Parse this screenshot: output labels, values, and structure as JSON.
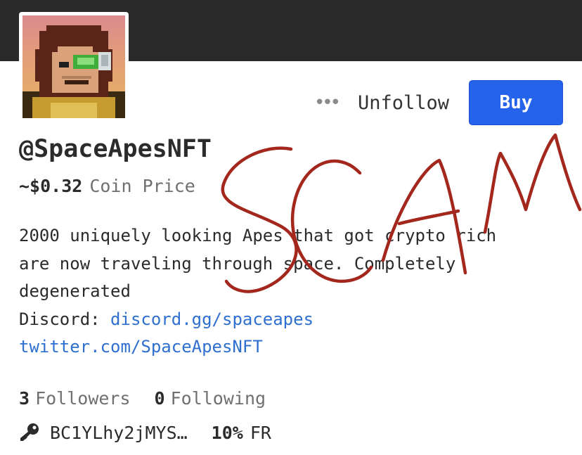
{
  "profile": {
    "handle": "@SpaceApesNFT",
    "coin_price_value": "~$0.32",
    "coin_price_label": "Coin Price",
    "avatar_icon": "pixel-ape-avatar"
  },
  "actions": {
    "more_icon": "more-dots-icon",
    "more_label": "•••",
    "unfollow_label": "Unfollow",
    "buy_label": "Buy",
    "buy_color": "#2563eb"
  },
  "bio": {
    "line1": "2000 uniquely looking Apes that got crypto rich",
    "line2": "are now traveling through space. Completely",
    "line3": "degenerated",
    "discord_label": "Discord: ",
    "discord_link": "discord.gg/spaceapes",
    "twitter_link": "twitter.com/SpaceApesNFT",
    "link_color": "#2f6fd0"
  },
  "stats": {
    "followers_count": "3",
    "followers_label": "Followers",
    "following_count": "0",
    "following_label": "Following"
  },
  "wallet": {
    "key_icon": "key-icon",
    "address": "BC1YLhy2jMYS…",
    "founder_reward_value": "10%",
    "founder_reward_label": "FR"
  },
  "annotation": {
    "text": "SCAM",
    "color": "#a3271c"
  }
}
